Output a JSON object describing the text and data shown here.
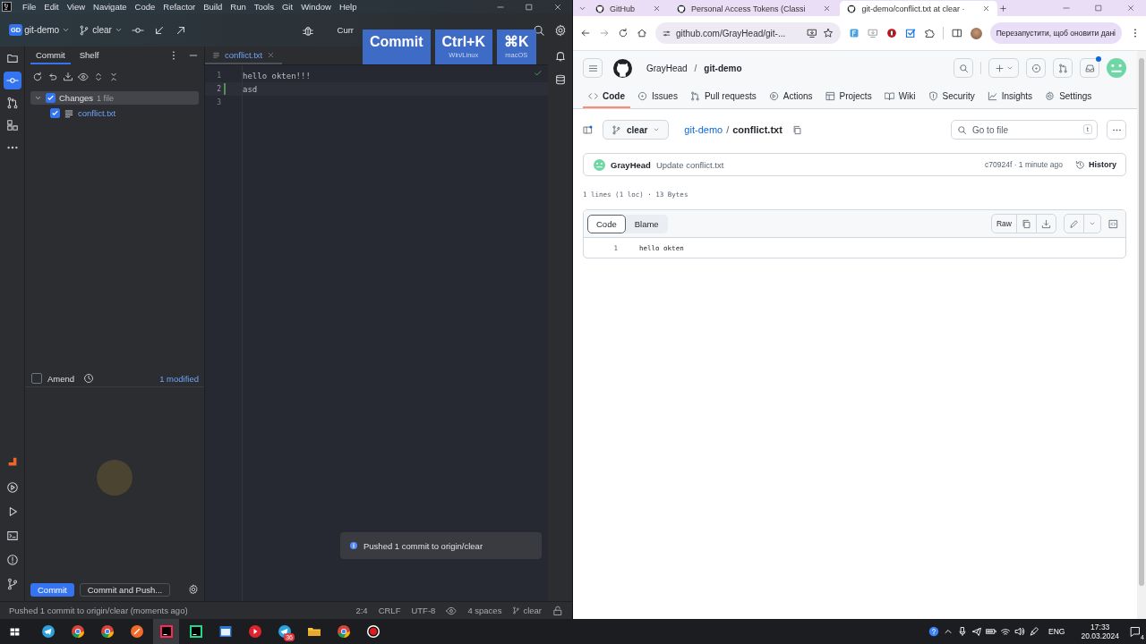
{
  "ide": {
    "menu": [
      "File",
      "Edit",
      "View",
      "Navigate",
      "Code",
      "Refactor",
      "Build",
      "Run",
      "Tools",
      "Git",
      "Window",
      "Help"
    ],
    "project": {
      "badge": "GD",
      "name": "git-demo"
    },
    "branch": "clear",
    "run_config": "Curr",
    "key_hint": [
      {
        "key": "Commit"
      },
      {
        "key": "Ctrl+K",
        "os": "Win/Linux"
      },
      {
        "key": "⌘K",
        "os": "macOS"
      }
    ],
    "tool_windows": [
      {
        "selected": false
      },
      {
        "selected": true
      },
      {
        "selected": false
      },
      {
        "selected": false
      },
      {
        "selected": false
      }
    ],
    "commit_panel": {
      "tabs": [
        {
          "label": "Commit",
          "selected": true
        },
        {
          "label": "Shelf",
          "selected": false
        }
      ],
      "changes": {
        "label": "Changes",
        "count": "1 file",
        "checked": true,
        "expanded": true,
        "children": [
          {
            "name": "conflict.txt",
            "checked": true
          }
        ]
      },
      "amend": {
        "label": "Amend",
        "checked": false
      },
      "modified": "1 modified",
      "buttons": [
        {
          "label": "Commit",
          "kind": "primary"
        },
        {
          "label": "Commit and Push...",
          "kind": "secondary"
        }
      ]
    },
    "editor": {
      "tab": "conflict.txt",
      "lines": [
        {
          "number": "1",
          "text": "hello okten!!!",
          "changed": false,
          "current": false
        },
        {
          "number": "2",
          "text": "asd",
          "changed": true,
          "current": true
        },
        {
          "number": "3",
          "changed": false,
          "current": false
        }
      ]
    },
    "notification": "Pushed 1 commit to origin/clear",
    "status_bar": {
      "message": "Pushed 1 commit to origin/clear (moments ago)",
      "items": [
        "2:4",
        "CRLF",
        "UTF-8"
      ],
      "indent": "4 spaces",
      "branch": "clear"
    }
  },
  "browser": {
    "tabs": [
      {
        "title": "GitHub",
        "selected": false
      },
      {
        "title": "Personal Access Tokens (Classi",
        "selected": false
      },
      {
        "title": "git-demo/conflict.txt at clear ·",
        "selected": true
      }
    ],
    "url": "github.com/GrayHead/git-...",
    "update_button": "Перезапустити, щоб оновити дані",
    "github": {
      "owner": "GrayHead",
      "repo": "git-demo",
      "nav": [
        {
          "label": "Code",
          "selected": true
        },
        {
          "label": "Issues",
          "selected": false
        },
        {
          "label": "Pull requests",
          "selected": false
        },
        {
          "label": "Actions",
          "selected": false
        },
        {
          "label": "Projects",
          "selected": false
        },
        {
          "label": "Wiki",
          "selected": false
        },
        {
          "label": "Security",
          "selected": false
        },
        {
          "label": "Insights",
          "selected": false
        },
        {
          "label": "Settings",
          "selected": false
        }
      ],
      "branch": "clear",
      "path": {
        "repo": "git-demo",
        "separator": "/",
        "file": "conflict.txt"
      },
      "go_to_file": {
        "placeholder": "Go to file",
        "shortcut": "t"
      },
      "commit": {
        "author": "GrayHead",
        "message": "Update conflict.txt",
        "meta": "c70924f · 1 minute ago",
        "history": "History"
      },
      "file_info": "1 lines (1 loc) · 13 Bytes",
      "view_tabs": [
        {
          "label": "Code",
          "selected": true
        },
        {
          "label": "Blame",
          "selected": false
        }
      ],
      "raw": "Raw",
      "lines": [
        {
          "number": "1",
          "text": "hello okten"
        }
      ]
    }
  },
  "taskbar": {
    "apps": [
      {
        "kind": "telegram",
        "active": false
      },
      {
        "kind": "chrome",
        "active": false
      },
      {
        "kind": "chrome",
        "active": false
      },
      {
        "kind": "pen",
        "active": false
      },
      {
        "kind": "intellij",
        "active": true
      },
      {
        "kind": "pycharm",
        "active": false
      },
      {
        "kind": "calendar",
        "active": false
      },
      {
        "kind": "media",
        "active": false
      },
      {
        "kind": "telegram",
        "active": false,
        "badge": "36"
      },
      {
        "kind": "explorer",
        "active": false
      },
      {
        "kind": "chrome",
        "active": false
      },
      {
        "kind": "recorder",
        "active": false
      }
    ],
    "language": "ENG",
    "time": "17:33",
    "date": "20.03.2024",
    "notifications": "4"
  }
}
